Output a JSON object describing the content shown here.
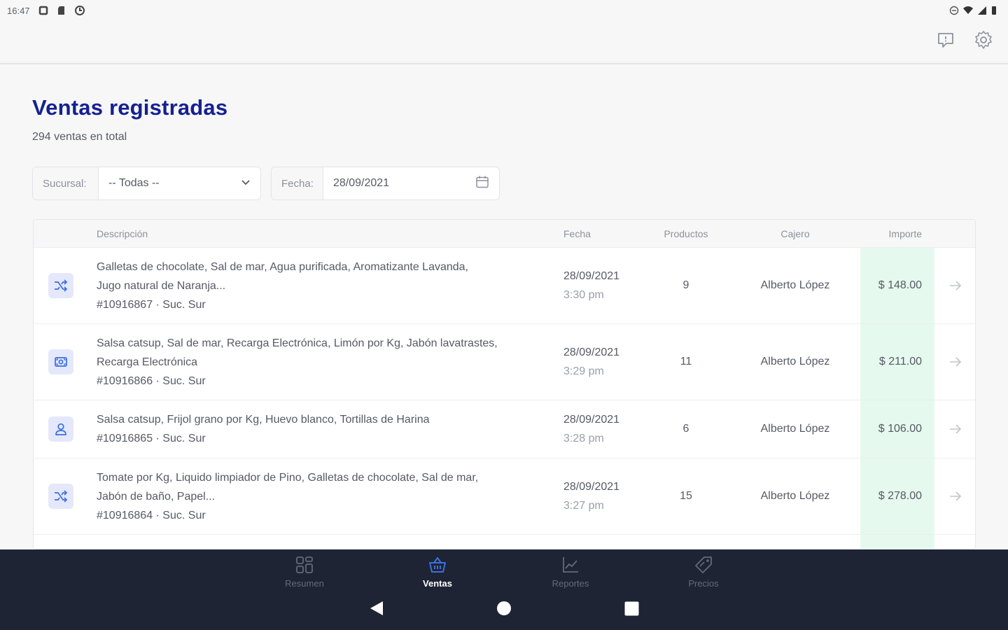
{
  "status_bar": {
    "time": "16:47"
  },
  "header": {
    "title": "Ventas registradas",
    "subtitle": "294 ventas en total"
  },
  "filters": {
    "branch": {
      "label": "Sucursal:",
      "value": "-- Todas --"
    },
    "date": {
      "label": "Fecha:",
      "value": "28/09/2021"
    }
  },
  "table": {
    "columns": [
      "Descripción",
      "Fecha",
      "Productos",
      "Cajero",
      "Importe"
    ],
    "rows": [
      {
        "icon": "shuffle-icon",
        "description_line1": "Galletas de chocolate, Sal de mar, Agua purificada, Aromatizante Lavanda,",
        "description_line2": "Jugo natural de Naranja...",
        "meta": "#10916867 · Suc. Sur",
        "date": "28/09/2021",
        "time": "3:30 pm",
        "products": "9",
        "cashier": "Alberto López",
        "amount": "$ 148.00"
      },
      {
        "icon": "cash-icon",
        "description_line1": "Salsa catsup, Sal de mar, Recarga Electrónica, Limón por Kg, Jabón lavatrastes,",
        "description_line2": "Recarga Electrónica",
        "meta": "#10916866 · Suc. Sur",
        "date": "28/09/2021",
        "time": "3:29 pm",
        "products": "11",
        "cashier": "Alberto López",
        "amount": "$ 211.00"
      },
      {
        "icon": "user-icon",
        "description_line1": "Salsa catsup, Frijol grano por Kg, Huevo blanco, Tortillas de Harina",
        "description_line2": "",
        "meta": "#10916865 · Suc. Sur",
        "date": "28/09/2021",
        "time": "3:28 pm",
        "products": "6",
        "cashier": "Alberto López",
        "amount": "$ 106.00"
      },
      {
        "icon": "shuffle-icon",
        "description_line1": "Tomate por Kg, Liquido limpiador de Pino, Galletas de chocolate, Sal de mar,",
        "description_line2": "Jabón de baño, Papel...",
        "meta": "#10916864 · Suc. Sur",
        "date": "28/09/2021",
        "time": "3:27 pm",
        "products": "15",
        "cashier": "Alberto López",
        "amount": "$ 278.00"
      }
    ]
  },
  "bottom_nav": {
    "tabs": [
      {
        "label": "Resumen",
        "icon": "dashboard-icon",
        "active": false
      },
      {
        "label": "Ventas",
        "icon": "basket-icon",
        "active": true
      },
      {
        "label": "Reportes",
        "icon": "chart-icon",
        "active": false
      },
      {
        "label": "Precios",
        "icon": "tag-icon",
        "active": false
      }
    ]
  },
  "colors": {
    "title": "#15218f",
    "accent": "#3b6fe0",
    "amount_bg": "#e6f9ee",
    "nav_bg": "#1e2433"
  }
}
